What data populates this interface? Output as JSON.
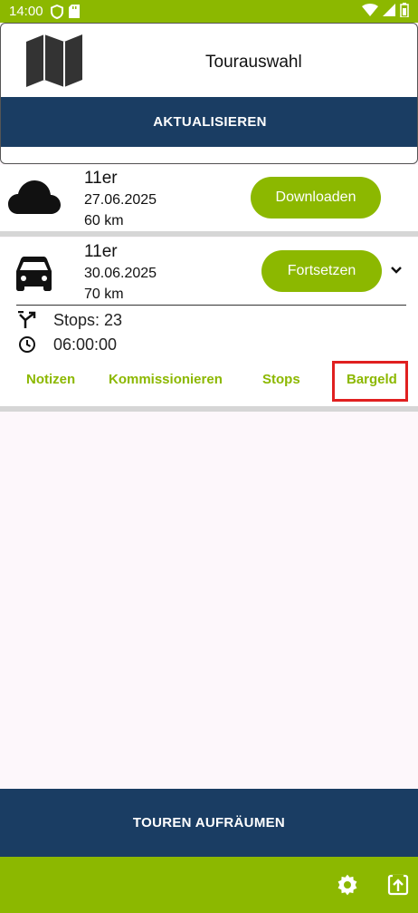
{
  "status_bar": {
    "time": "14:00",
    "left_icons": [
      "shield-icon",
      "sd-card-icon"
    ],
    "right_icons": [
      "wifi-icon",
      "signal-icon",
      "battery-icon"
    ]
  },
  "header": {
    "title": "Tourauswahl",
    "refresh_label": "AKTUALISIEREN"
  },
  "tours": [
    {
      "name": "11er",
      "date": "27.06.2025",
      "distance": "60 km",
      "icon": "cloud-icon",
      "action_label": "Downloaden"
    },
    {
      "name": "11er",
      "date": "30.06.2025",
      "distance": "70 km",
      "icon": "car-icon",
      "action_label": "Fortsetzen",
      "stops": "Stops: 23",
      "duration": "06:00:00",
      "links": [
        "Notizen",
        "Kommissionieren",
        "Stops",
        "Bargeld"
      ]
    }
  ],
  "footer": {
    "cleanup_label": "TOUREN AUFRÄUMEN",
    "icons": [
      "settings-icon",
      "exit-app-icon"
    ]
  },
  "colors": {
    "accent_green": "#8cb800",
    "navy": "#1a3d63",
    "highlight_red": "#e02020"
  }
}
